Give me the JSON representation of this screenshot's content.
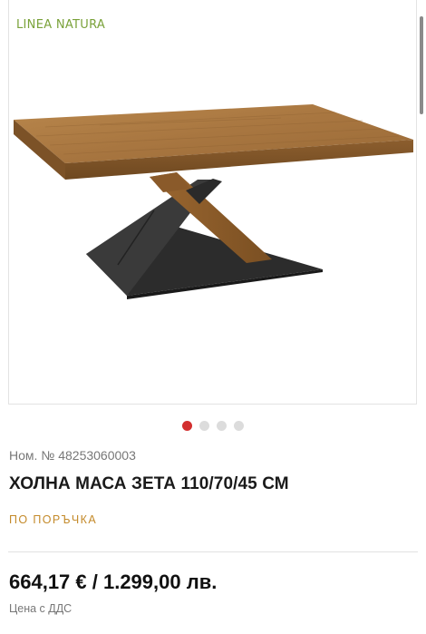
{
  "brand": {
    "logo_text": "LINEA NATURA",
    "color": "#7aa23a"
  },
  "gallery": {
    "image_alt": "coffee-table-photo",
    "slides": 4,
    "active_slide": 1,
    "active_color": "#d32f2f"
  },
  "product": {
    "sku": "Ном. № 48253060003",
    "title": "ХОЛНА МАСА ЗЕТА 110/70/45 СМ",
    "availability": "ПО ПОРЪЧКА",
    "price": "664,17 € / 1.299,00 лв.",
    "price_note": "Цена с ДДС"
  }
}
